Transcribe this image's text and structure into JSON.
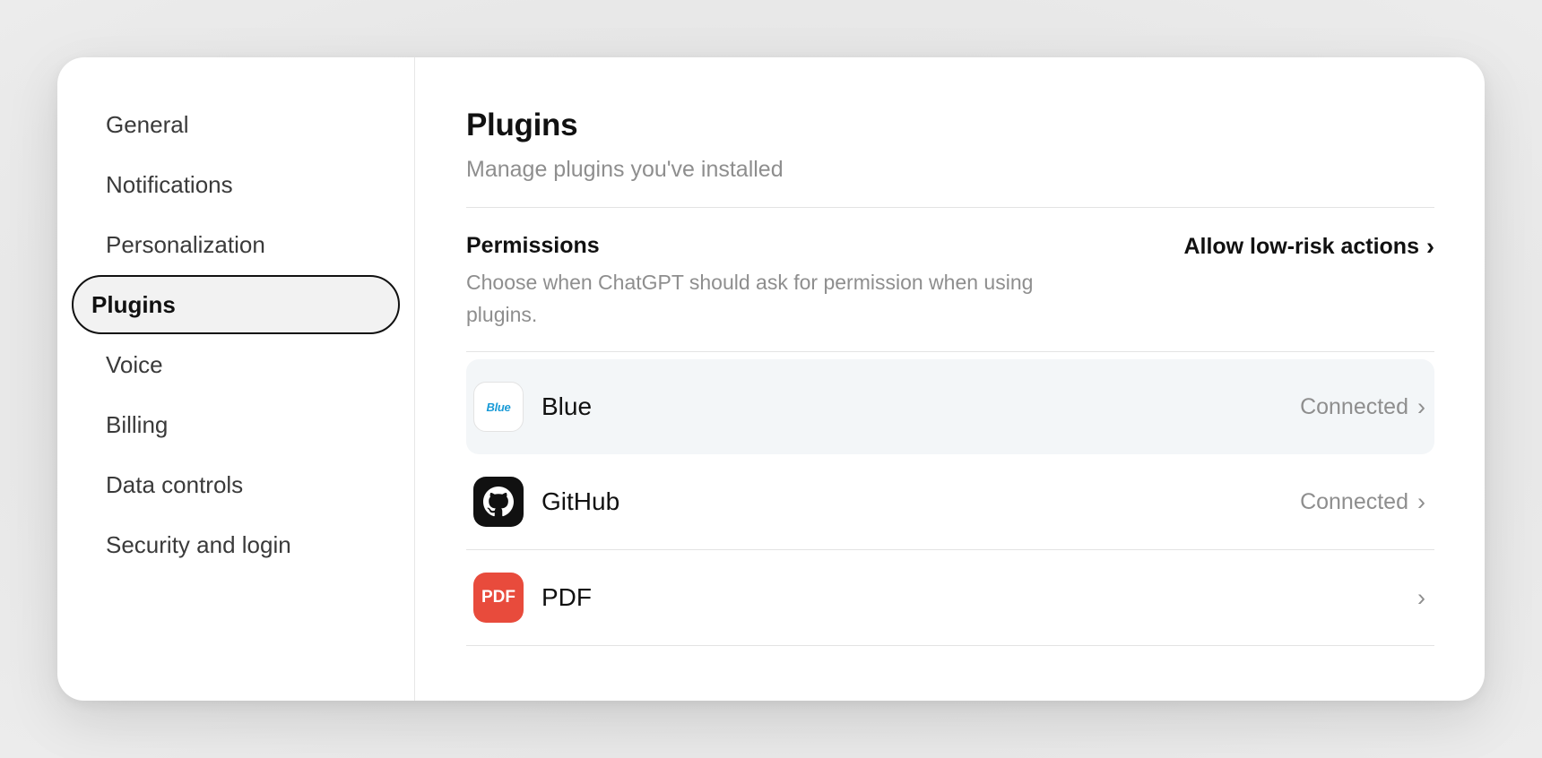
{
  "sidebar": {
    "items": [
      {
        "label": "General"
      },
      {
        "label": "Notifications"
      },
      {
        "label": "Personalization"
      },
      {
        "label": "Plugins",
        "active": true
      },
      {
        "label": "Voice"
      },
      {
        "label": "Billing"
      },
      {
        "label": "Data controls"
      },
      {
        "label": "Security and login"
      }
    ]
  },
  "main": {
    "title": "Plugins",
    "subtitle": "Manage plugins you've installed",
    "permissions": {
      "title": "Permissions",
      "description": "Choose when ChatGPT should ask for permission when using plugins.",
      "action_label": "Allow low-risk actions",
      "action_chevron": "›"
    },
    "plugins": [
      {
        "name": "Blue",
        "icon": "blue-logo-icon",
        "icon_text": "Blue",
        "status": "Connected",
        "chevron": "›"
      },
      {
        "name": "GitHub",
        "icon": "github-icon",
        "status": "Connected",
        "chevron": "›"
      },
      {
        "name": "PDF",
        "icon": "pdf-icon",
        "icon_text": "PDF",
        "status": "",
        "chevron": "›"
      }
    ]
  },
  "colors": {
    "accent_blue": "#1a9bd7",
    "pdf_red": "#e84b3c",
    "github_black": "#111111",
    "muted_text": "#8e8e8e",
    "hover_row": "#f3f6f8"
  }
}
